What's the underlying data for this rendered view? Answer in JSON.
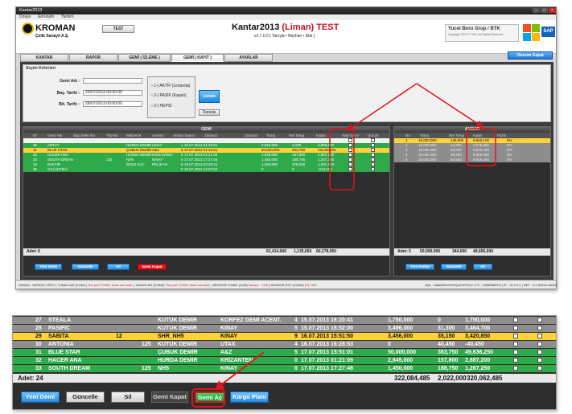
{
  "window": {
    "title": "Kantar2013"
  },
  "menu": [
    "Dosya",
    "Görünüm",
    "Yardım"
  ],
  "header": {
    "logo_name": "KROMAN",
    "logo_sub": "Çelik Sanayii A.Ş.",
    "test_button": "TEST",
    "app_title": "Kantar2013",
    "app_title_liman": "(Liman)",
    "app_title_test": "TEST",
    "version": "v2.7.0.0",
    "version_note": "[ Tanıyla • Beyhan • Ebk ]",
    "company_name": "Yucel Boru Grup / BTK",
    "company_note": "Copyright 2012 © YBG. All Rights Reserved",
    "sap": "SAP"
  },
  "tabs": [
    "KANTAR",
    "RAPOR",
    "GEMİ ( İZLEME )",
    "GEMİ ( KAYIT )",
    "AYARLAR"
  ],
  "selected_tab": "GEMİ ( KAYIT )",
  "logout_button": "Oturum Kapat",
  "criteria": {
    "title": "Seçim Kriterleri",
    "ship_label": "Gemi Adı :",
    "ship_value": "",
    "start_label": "Baş. Tarihi :",
    "start_value": "20/07/2012 00:00:00",
    "end_label": "Bit. Tarihi :",
    "end_value": "28/07/2013 00:00:00",
    "radio1": "1-) AKTİF (Limanda)",
    "radio2": "2-) PASİF (Kapalı)",
    "radio3": "3-) HEPSİ",
    "list_button": "Listele",
    "clear_button": "Temizle"
  },
  "gemi_panel": {
    "title": "GEMİ",
    "columns": [
      "ID",
      "Gemi Adı",
      "Sap Sefer No",
      "Trip No",
      "Malzeme",
      "Acenta",
      "Ambar Sayısı",
      "Zaman1",
      "Zaman2",
      "Tonaj",
      "Net Tonaj",
      "Kalan",
      "Sakl Gemi",
      "Durum"
    ],
    "rows": [
      {
        "id": "",
        "name": "",
        "sap": "",
        "trip": "",
        "mat": "",
        "acenta": "",
        "ambar": "",
        "z1": "",
        "z2": "",
        "tonaj": "",
        "net": "",
        "kalan": "",
        "style": "white"
      },
      {
        "id": "30",
        "name": "ARTVY",
        "sap": "",
        "trip": "",
        "mat": "HURDA DEMİR",
        "acenta": "UMAY",
        "ambar": "1",
        "z1": "15.07.2013 01:46:01",
        "z2": "",
        "tonaj": "2,845,000",
        "net": "3,100",
        "kalan": "2,859,900",
        "style": "green"
      },
      {
        "id": "31",
        "name": "BLUE STAR",
        "sap": "",
        "trip": "",
        "mat": "ÇUBUK DEMİR",
        "acenta": "A&Z",
        "ambar": "5",
        "z1": "17.07.2013 01:15:01",
        "z2": "",
        "tonaj": "50,000,000",
        "net": "363,750",
        "kalan": "49,636,250",
        "style": "yellow"
      },
      {
        "id": "32",
        "name": "HACER ANA",
        "sap": "",
        "trip": "",
        "mat": "HURDA DEMİR",
        "acenta": "KRİZANTEN",
        "ambar": "0",
        "z1": "17.07.2013 01:21:09",
        "z2": "",
        "tonaj": "2,845,000",
        "net": "157,800",
        "kalan": "2,687,200",
        "style": "green"
      },
      {
        "id": "33",
        "name": "SOUTH DREAM",
        "sap": "",
        "trip": "125",
        "mat": "NH5",
        "acenta": "KINAY",
        "ambar": "0",
        "z1": "17.07.2013 17:27:48",
        "z2": "",
        "tonaj": "1,450,000",
        "net": "188,750",
        "kalan": "1,267,250",
        "style": "green"
      },
      {
        "id": "34",
        "name": "BAKTIR",
        "sap": "",
        "trip": "",
        "mat": "BOLD SAC",
        "acenta": "PELİKAN",
        "ambar": "0",
        "z1": "18.07.2013 03:29:21",
        "z2": "",
        "tonaj": "4,250,000",
        "net": "378,500",
        "kalan": "4,001,500",
        "style": "green"
      },
      {
        "id": "35",
        "name": "GALAKTİKA",
        "sap": "",
        "trip": "",
        "mat": "",
        "acenta": "",
        "ambar": "0",
        "z1": "19.07.2013 14:07:54",
        "z2": "",
        "tonaj": "0",
        "net": "0",
        "kalan": "-243,150",
        "style": "green"
      }
    ],
    "total_label": "Adet: 6",
    "totals": {
      "tonaj": "61,414,600",
      "net": "1,135,650",
      "kalan": "60,278,950"
    },
    "buttons": {
      "new": "Yeni Gemi",
      "update": "Güncelle",
      "delete": "Sil",
      "close": "Gemi Kapat"
    }
  },
  "ambar_panel": {
    "title": "AMBAR",
    "columns": [
      "No",
      "Tonaj",
      "Net Tonaj",
      "Kalan",
      "Fazla"
    ],
    "rows": [
      {
        "no": "1",
        "tonaj": "10,000,000",
        "net": "139,900",
        "kalan": "9,860,100",
        "fazla": "0%",
        "style": "yellow"
      },
      {
        "no": "2",
        "tonaj": "10,000,000",
        "net": "24,300",
        "kalan": "9,975,800",
        "fazla": "0%",
        "style": "gray"
      },
      {
        "no": "3",
        "tonaj": "10,000,000",
        "net": "56,900",
        "kalan": "9,943,100",
        "fazla": "0%",
        "style": "gray"
      },
      {
        "no": "4",
        "tonaj": "10,000,000",
        "net": "39,450",
        "kalan": "9,960,550",
        "fazla": "0%",
        "style": "gray"
      },
      {
        "no": "5",
        "tonaj": "10,000,000",
        "net": "83,550",
        "kalan": "9,916,450",
        "fazla": "0%",
        "style": "gray"
      }
    ],
    "total_label": "Adet: 5",
    "totals": {
      "tonaj": "50,000,000",
      "net": "344,000",
      "kalan": "49,656,000"
    },
    "buttons": {
      "new": "Yeni Ambar",
      "update": "Güncelle",
      "delete": "Sil"
    }
  },
  "statusbar": {
    "user": "HASAN : SAP530 / TEST",
    "scale1": "TUNAYLAR (COM1)",
    "scale1_msg": "The port 'COM1' does not exist.",
    "scale2": "TUNAYLAR (COM2)",
    "scale2_msg": "The port 'COM2' does not exist.",
    "sensor1": "SENSOR TUNAY (USB)",
    "sensor1_msg": "Sensor : YOK",
    "sensor2": "SENSOR EST (COM2)",
    "sensor2_msg": "(P) YOK",
    "sql": "SQL : SANDBEGO\\SQLEXP2012",
    "pc": "PC : SANDBEGO",
    "ip": "IP : 10.0.0.4",
    "net": "NET : 4.0.30319.18052"
  },
  "zoom": {
    "rows": [
      {
        "id": "27",
        "name": "STEALA",
        "trip": "",
        "sefer": "",
        "mat": "KÜTÜK DEMİR",
        "acenta": "KÖRFEZ GEMİ ACENT.",
        "ambar": "4",
        "zaman": "15.07.2013 16:20:41",
        "tonaj": "1,750,000",
        "net": "0",
        "kalan": "1,750,000",
        "style": "gray"
      },
      {
        "id": "28",
        "name": "PASIFIC",
        "trip": "",
        "sefer": "",
        "mat": "KÜTÜK DEMİR",
        "acenta": "KINAY",
        "ambar": "5",
        "zaman": "15.07.2013 16:52:00",
        "tonaj": "3,496,000",
        "net": "31,300",
        "kalan": "3,464,700",
        "style": "gray"
      },
      {
        "id": "29",
        "name": "SABITA",
        "trip": "12",
        "sefer": "",
        "mat": "SHR_NH5",
        "acenta": "KINAY",
        "ambar": "9",
        "zaman": "16.07.2013 15:51:50",
        "tonaj": "3,456,000",
        "net": "35,150",
        "kalan": "3,420,850",
        "style": "yellow"
      },
      {
        "id": "30",
        "name": "ANTONIA",
        "trip": "",
        "sefer": "125",
        "mat": "KÜTÜK DEMİR",
        "acenta": "UTAX",
        "ambar": "4",
        "zaman": "16.07.2013 16:28:53",
        "tonaj": "0",
        "net": "40,450",
        "kalan": "-40,450",
        "style": "gray"
      },
      {
        "id": "31",
        "name": "BLUE STAR",
        "trip": "",
        "sefer": "",
        "mat": "ÇUBUK DEMİR",
        "acenta": "A&Z",
        "ambar": "5",
        "zaman": "17.07.2013 15:51:01",
        "tonaj": "50,000,000",
        "net": "363,750",
        "kalan": "49,636,250",
        "style": "green"
      },
      {
        "id": "32",
        "name": "HACER ANA",
        "trip": "",
        "sefer": "",
        "mat": "HURDA DEMİR",
        "acenta": "KRİZANTEN",
        "ambar": "0",
        "zaman": "17.07.2013 01:21:09",
        "tonaj": "2,845,000",
        "net": "157,800",
        "kalan": "2,687,200",
        "style": "green"
      },
      {
        "id": "33",
        "name": "SOUTH DREAM",
        "trip": "",
        "sefer": "125",
        "mat": "NH5",
        "acenta": "KINAY",
        "ambar": "0",
        "zaman": "17.07.2013 17:27:48",
        "tonaj": "1,450,000",
        "net": "188,750",
        "kalan": "1,267,250",
        "style": "green"
      }
    ],
    "total_label": "Adet: 24",
    "totals": {
      "tonaj": "322,084,485",
      "net": "2,022,000",
      "kalan": "320,062,485"
    },
    "buttons": {
      "new": "Yeni Gemi",
      "update": "Güncelle",
      "delete": "Sil",
      "close": "Gemi Kapat",
      "open": "Gemi Aç",
      "cargo": "Kargo Planı"
    }
  },
  "colors": {
    "green": "#2eaa4a",
    "yellow": "#ffd23a",
    "blue": "#2289de",
    "red": "#e3141b",
    "annotation": "#e0141b"
  }
}
